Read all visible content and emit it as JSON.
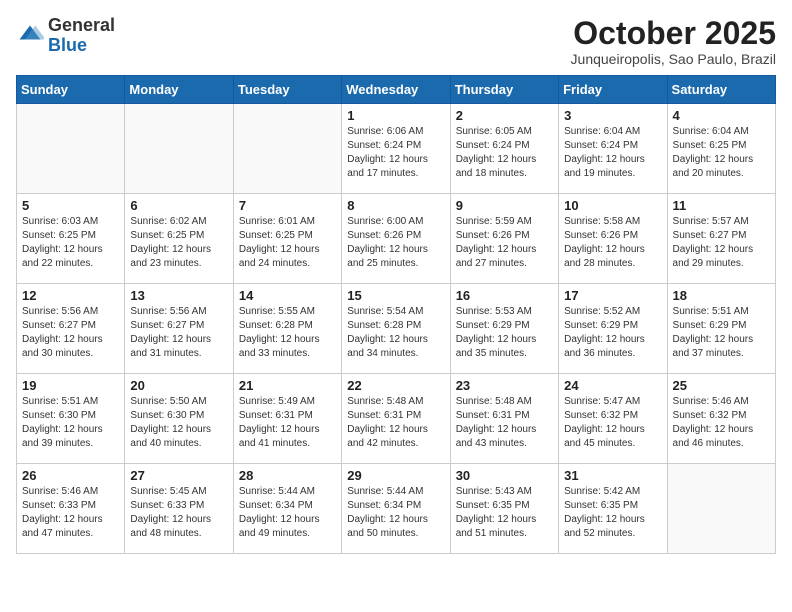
{
  "header": {
    "logo_general": "General",
    "logo_blue": "Blue",
    "month_title": "October 2025",
    "location": "Junqueiropolis, Sao Paulo, Brazil"
  },
  "weekdays": [
    "Sunday",
    "Monday",
    "Tuesday",
    "Wednesday",
    "Thursday",
    "Friday",
    "Saturday"
  ],
  "weeks": [
    [
      {
        "day": "",
        "info": ""
      },
      {
        "day": "",
        "info": ""
      },
      {
        "day": "",
        "info": ""
      },
      {
        "day": "1",
        "info": "Sunrise: 6:06 AM\nSunset: 6:24 PM\nDaylight: 12 hours\nand 17 minutes."
      },
      {
        "day": "2",
        "info": "Sunrise: 6:05 AM\nSunset: 6:24 PM\nDaylight: 12 hours\nand 18 minutes."
      },
      {
        "day": "3",
        "info": "Sunrise: 6:04 AM\nSunset: 6:24 PM\nDaylight: 12 hours\nand 19 minutes."
      },
      {
        "day": "4",
        "info": "Sunrise: 6:04 AM\nSunset: 6:25 PM\nDaylight: 12 hours\nand 20 minutes."
      }
    ],
    [
      {
        "day": "5",
        "info": "Sunrise: 6:03 AM\nSunset: 6:25 PM\nDaylight: 12 hours\nand 22 minutes."
      },
      {
        "day": "6",
        "info": "Sunrise: 6:02 AM\nSunset: 6:25 PM\nDaylight: 12 hours\nand 23 minutes."
      },
      {
        "day": "7",
        "info": "Sunrise: 6:01 AM\nSunset: 6:25 PM\nDaylight: 12 hours\nand 24 minutes."
      },
      {
        "day": "8",
        "info": "Sunrise: 6:00 AM\nSunset: 6:26 PM\nDaylight: 12 hours\nand 25 minutes."
      },
      {
        "day": "9",
        "info": "Sunrise: 5:59 AM\nSunset: 6:26 PM\nDaylight: 12 hours\nand 27 minutes."
      },
      {
        "day": "10",
        "info": "Sunrise: 5:58 AM\nSunset: 6:26 PM\nDaylight: 12 hours\nand 28 minutes."
      },
      {
        "day": "11",
        "info": "Sunrise: 5:57 AM\nSunset: 6:27 PM\nDaylight: 12 hours\nand 29 minutes."
      }
    ],
    [
      {
        "day": "12",
        "info": "Sunrise: 5:56 AM\nSunset: 6:27 PM\nDaylight: 12 hours\nand 30 minutes."
      },
      {
        "day": "13",
        "info": "Sunrise: 5:56 AM\nSunset: 6:27 PM\nDaylight: 12 hours\nand 31 minutes."
      },
      {
        "day": "14",
        "info": "Sunrise: 5:55 AM\nSunset: 6:28 PM\nDaylight: 12 hours\nand 33 minutes."
      },
      {
        "day": "15",
        "info": "Sunrise: 5:54 AM\nSunset: 6:28 PM\nDaylight: 12 hours\nand 34 minutes."
      },
      {
        "day": "16",
        "info": "Sunrise: 5:53 AM\nSunset: 6:29 PM\nDaylight: 12 hours\nand 35 minutes."
      },
      {
        "day": "17",
        "info": "Sunrise: 5:52 AM\nSunset: 6:29 PM\nDaylight: 12 hours\nand 36 minutes."
      },
      {
        "day": "18",
        "info": "Sunrise: 5:51 AM\nSunset: 6:29 PM\nDaylight: 12 hours\nand 37 minutes."
      }
    ],
    [
      {
        "day": "19",
        "info": "Sunrise: 5:51 AM\nSunset: 6:30 PM\nDaylight: 12 hours\nand 39 minutes."
      },
      {
        "day": "20",
        "info": "Sunrise: 5:50 AM\nSunset: 6:30 PM\nDaylight: 12 hours\nand 40 minutes."
      },
      {
        "day": "21",
        "info": "Sunrise: 5:49 AM\nSunset: 6:31 PM\nDaylight: 12 hours\nand 41 minutes."
      },
      {
        "day": "22",
        "info": "Sunrise: 5:48 AM\nSunset: 6:31 PM\nDaylight: 12 hours\nand 42 minutes."
      },
      {
        "day": "23",
        "info": "Sunrise: 5:48 AM\nSunset: 6:31 PM\nDaylight: 12 hours\nand 43 minutes."
      },
      {
        "day": "24",
        "info": "Sunrise: 5:47 AM\nSunset: 6:32 PM\nDaylight: 12 hours\nand 45 minutes."
      },
      {
        "day": "25",
        "info": "Sunrise: 5:46 AM\nSunset: 6:32 PM\nDaylight: 12 hours\nand 46 minutes."
      }
    ],
    [
      {
        "day": "26",
        "info": "Sunrise: 5:46 AM\nSunset: 6:33 PM\nDaylight: 12 hours\nand 47 minutes."
      },
      {
        "day": "27",
        "info": "Sunrise: 5:45 AM\nSunset: 6:33 PM\nDaylight: 12 hours\nand 48 minutes."
      },
      {
        "day": "28",
        "info": "Sunrise: 5:44 AM\nSunset: 6:34 PM\nDaylight: 12 hours\nand 49 minutes."
      },
      {
        "day": "29",
        "info": "Sunrise: 5:44 AM\nSunset: 6:34 PM\nDaylight: 12 hours\nand 50 minutes."
      },
      {
        "day": "30",
        "info": "Sunrise: 5:43 AM\nSunset: 6:35 PM\nDaylight: 12 hours\nand 51 minutes."
      },
      {
        "day": "31",
        "info": "Sunrise: 5:42 AM\nSunset: 6:35 PM\nDaylight: 12 hours\nand 52 minutes."
      },
      {
        "day": "",
        "info": ""
      }
    ]
  ]
}
